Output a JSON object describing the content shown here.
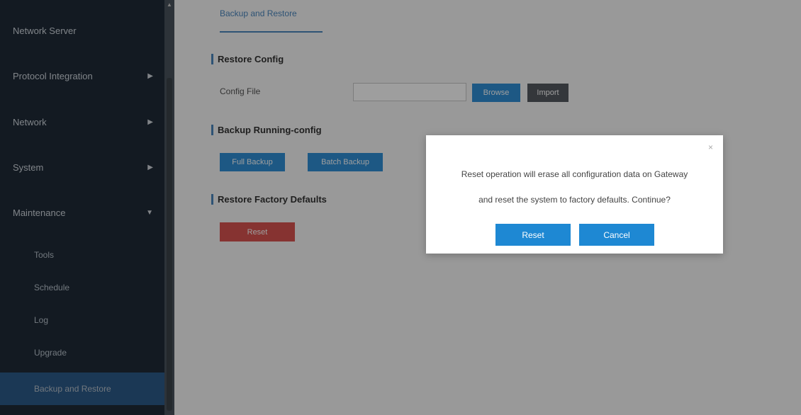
{
  "sidebar": {
    "items": [
      {
        "label": "Network Server",
        "has_arrow": false
      },
      {
        "label": "Protocol Integration",
        "has_arrow": true
      },
      {
        "label": "Network",
        "has_arrow": true
      },
      {
        "label": "System",
        "has_arrow": true
      },
      {
        "label": "Maintenance",
        "has_arrow": true
      }
    ],
    "subitems": [
      {
        "label": "Tools"
      },
      {
        "label": "Schedule"
      },
      {
        "label": "Log"
      },
      {
        "label": "Upgrade"
      },
      {
        "label": "Backup and Restore",
        "active": true
      }
    ],
    "arrow_right_icon": "▶",
    "arrow_down_icon": "▼",
    "scroll_caret_icon": "▲"
  },
  "main": {
    "tab_label": "Backup and Restore",
    "restore_config": {
      "title": "Restore Config",
      "config_file_label": "Config File",
      "config_file_value": "",
      "browse_label": "Browse",
      "import_label": "Import"
    },
    "backup": {
      "title": "Backup Running-config",
      "full_backup_label": "Full Backup",
      "batch_backup_label": "Batch Backup"
    },
    "factory": {
      "title": "Restore Factory Defaults",
      "reset_label": "Reset"
    }
  },
  "modal": {
    "close_icon": "×",
    "message_line1": "Reset operation will erase all configuration data on Gateway",
    "message_line2": "and reset the system to factory defaults. Continue?",
    "reset_label": "Reset",
    "cancel_label": "Cancel"
  },
  "colors": {
    "sidebar_bg": "#1f2b38",
    "accent_blue": "#2f8fd6",
    "danger_red": "#d9534f",
    "active_item": "#2d5b8a"
  }
}
